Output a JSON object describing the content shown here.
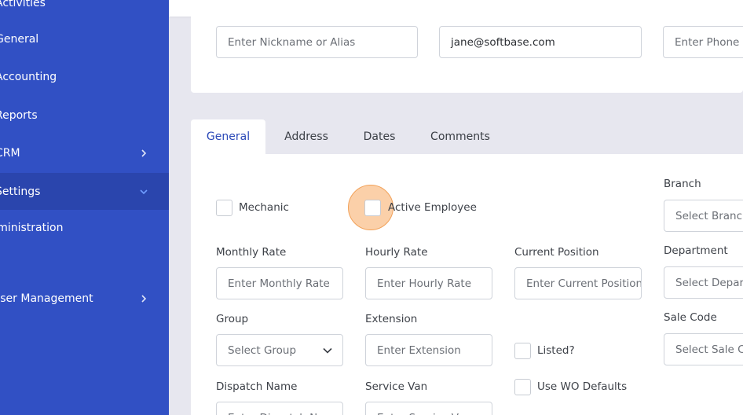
{
  "sidebar": {
    "items": [
      {
        "label": "Activities"
      },
      {
        "label": "General"
      },
      {
        "label": "Accounting"
      },
      {
        "label": "Reports"
      },
      {
        "label": "CRM"
      },
      {
        "label": "Settings"
      },
      {
        "label": "Administration"
      },
      {
        "label": "User Management"
      }
    ]
  },
  "contact": {
    "nickname_placeholder": "Enter Nickname or Alias",
    "email_value": "jane@softbase.com",
    "phone_placeholder": "Enter Phone #"
  },
  "tabs": [
    "General",
    "Address",
    "Dates",
    "Comments"
  ],
  "form": {
    "mechanic_label": "Mechanic",
    "active_employee_label": "Active Employee",
    "branch_label": "Branch",
    "branch_placeholder": "Select Branch",
    "monthly_rate_label": "Monthly Rate",
    "monthly_rate_placeholder": "Enter Monthly Rate",
    "hourly_rate_label": "Hourly Rate",
    "hourly_rate_placeholder": "Enter Hourly Rate",
    "current_position_label": "Current Position",
    "current_position_placeholder": "Enter Current Position",
    "department_label": "Department",
    "department_placeholder": "Select Department",
    "group_label": "Group",
    "group_placeholder": "Select Group",
    "extension_label": "Extension",
    "extension_placeholder": "Enter Extension",
    "listed_label": "Listed?",
    "sale_code_label": "Sale Code",
    "sale_code_placeholder": "Select Sale Code",
    "dispatch_name_label": "Dispatch Name",
    "dispatch_name_placeholder": "Enter Dispatch Name",
    "service_van_label": "Service Van",
    "service_van_placeholder": "Enter Service Van",
    "use_wo_defaults_label": "Use WO Defaults"
  },
  "colors": {
    "sidebar": "#3150c4",
    "sidebar_active": "#2a45ad",
    "accent": "#2b49b8",
    "highlight": "#f8aa62"
  }
}
